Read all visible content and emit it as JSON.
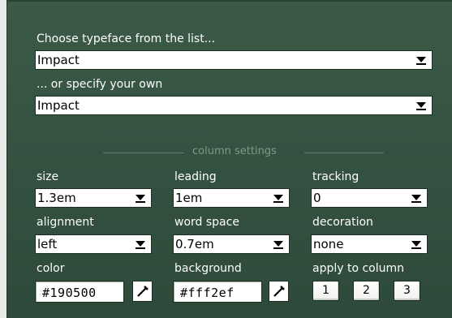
{
  "typeface": {
    "list_label": "Choose typeface from the list...",
    "list_value": "Impact",
    "custom_label": "... or specify your own",
    "custom_value": "Impact"
  },
  "section": {
    "title": "column settings"
  },
  "settings": {
    "size": {
      "label": "size",
      "value": "1.3em"
    },
    "leading": {
      "label": "leading",
      "value": "1em"
    },
    "tracking": {
      "label": "tracking",
      "value": "0"
    },
    "alignment": {
      "label": "alignment",
      "value": "left"
    },
    "word_space": {
      "label": "word space",
      "value": "0.7em"
    },
    "decoration": {
      "label": "decoration",
      "value": "none"
    }
  },
  "colors": {
    "color": {
      "label": "color",
      "value": "#190500"
    },
    "background": {
      "label": "background",
      "value": "#fff2ef"
    }
  },
  "apply": {
    "label": "apply to column",
    "buttons": [
      "1",
      "2",
      "3"
    ]
  },
  "icons": {
    "picker": "eyedropper-icon",
    "dropdown": "chevron-down-icon"
  },
  "theme": {
    "panel": "#355343",
    "text": "#ffffff",
    "muted": "#7e9a88"
  }
}
